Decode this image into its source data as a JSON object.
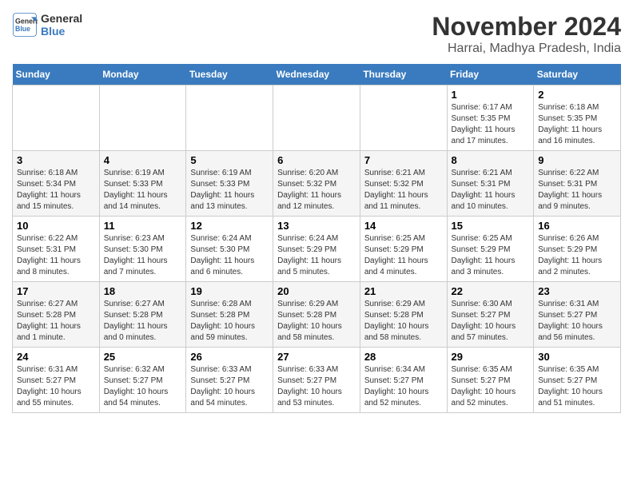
{
  "header": {
    "logo_line1": "General",
    "logo_line2": "Blue",
    "month": "November 2024",
    "location": "Harrai, Madhya Pradesh, India"
  },
  "weekdays": [
    "Sunday",
    "Monday",
    "Tuesday",
    "Wednesday",
    "Thursday",
    "Friday",
    "Saturday"
  ],
  "weeks": [
    [
      {
        "day": "",
        "info": ""
      },
      {
        "day": "",
        "info": ""
      },
      {
        "day": "",
        "info": ""
      },
      {
        "day": "",
        "info": ""
      },
      {
        "day": "",
        "info": ""
      },
      {
        "day": "1",
        "info": "Sunrise: 6:17 AM\nSunset: 5:35 PM\nDaylight: 11 hours and 17 minutes."
      },
      {
        "day": "2",
        "info": "Sunrise: 6:18 AM\nSunset: 5:35 PM\nDaylight: 11 hours and 16 minutes."
      }
    ],
    [
      {
        "day": "3",
        "info": "Sunrise: 6:18 AM\nSunset: 5:34 PM\nDaylight: 11 hours and 15 minutes."
      },
      {
        "day": "4",
        "info": "Sunrise: 6:19 AM\nSunset: 5:33 PM\nDaylight: 11 hours and 14 minutes."
      },
      {
        "day": "5",
        "info": "Sunrise: 6:19 AM\nSunset: 5:33 PM\nDaylight: 11 hours and 13 minutes."
      },
      {
        "day": "6",
        "info": "Sunrise: 6:20 AM\nSunset: 5:32 PM\nDaylight: 11 hours and 12 minutes."
      },
      {
        "day": "7",
        "info": "Sunrise: 6:21 AM\nSunset: 5:32 PM\nDaylight: 11 hours and 11 minutes."
      },
      {
        "day": "8",
        "info": "Sunrise: 6:21 AM\nSunset: 5:31 PM\nDaylight: 11 hours and 10 minutes."
      },
      {
        "day": "9",
        "info": "Sunrise: 6:22 AM\nSunset: 5:31 PM\nDaylight: 11 hours and 9 minutes."
      }
    ],
    [
      {
        "day": "10",
        "info": "Sunrise: 6:22 AM\nSunset: 5:31 PM\nDaylight: 11 hours and 8 minutes."
      },
      {
        "day": "11",
        "info": "Sunrise: 6:23 AM\nSunset: 5:30 PM\nDaylight: 11 hours and 7 minutes."
      },
      {
        "day": "12",
        "info": "Sunrise: 6:24 AM\nSunset: 5:30 PM\nDaylight: 11 hours and 6 minutes."
      },
      {
        "day": "13",
        "info": "Sunrise: 6:24 AM\nSunset: 5:29 PM\nDaylight: 11 hours and 5 minutes."
      },
      {
        "day": "14",
        "info": "Sunrise: 6:25 AM\nSunset: 5:29 PM\nDaylight: 11 hours and 4 minutes."
      },
      {
        "day": "15",
        "info": "Sunrise: 6:25 AM\nSunset: 5:29 PM\nDaylight: 11 hours and 3 minutes."
      },
      {
        "day": "16",
        "info": "Sunrise: 6:26 AM\nSunset: 5:29 PM\nDaylight: 11 hours and 2 minutes."
      }
    ],
    [
      {
        "day": "17",
        "info": "Sunrise: 6:27 AM\nSunset: 5:28 PM\nDaylight: 11 hours and 1 minute."
      },
      {
        "day": "18",
        "info": "Sunrise: 6:27 AM\nSunset: 5:28 PM\nDaylight: 11 hours and 0 minutes."
      },
      {
        "day": "19",
        "info": "Sunrise: 6:28 AM\nSunset: 5:28 PM\nDaylight: 10 hours and 59 minutes."
      },
      {
        "day": "20",
        "info": "Sunrise: 6:29 AM\nSunset: 5:28 PM\nDaylight: 10 hours and 58 minutes."
      },
      {
        "day": "21",
        "info": "Sunrise: 6:29 AM\nSunset: 5:28 PM\nDaylight: 10 hours and 58 minutes."
      },
      {
        "day": "22",
        "info": "Sunrise: 6:30 AM\nSunset: 5:27 PM\nDaylight: 10 hours and 57 minutes."
      },
      {
        "day": "23",
        "info": "Sunrise: 6:31 AM\nSunset: 5:27 PM\nDaylight: 10 hours and 56 minutes."
      }
    ],
    [
      {
        "day": "24",
        "info": "Sunrise: 6:31 AM\nSunset: 5:27 PM\nDaylight: 10 hours and 55 minutes."
      },
      {
        "day": "25",
        "info": "Sunrise: 6:32 AM\nSunset: 5:27 PM\nDaylight: 10 hours and 54 minutes."
      },
      {
        "day": "26",
        "info": "Sunrise: 6:33 AM\nSunset: 5:27 PM\nDaylight: 10 hours and 54 minutes."
      },
      {
        "day": "27",
        "info": "Sunrise: 6:33 AM\nSunset: 5:27 PM\nDaylight: 10 hours and 53 minutes."
      },
      {
        "day": "28",
        "info": "Sunrise: 6:34 AM\nSunset: 5:27 PM\nDaylight: 10 hours and 52 minutes."
      },
      {
        "day": "29",
        "info": "Sunrise: 6:35 AM\nSunset: 5:27 PM\nDaylight: 10 hours and 52 minutes."
      },
      {
        "day": "30",
        "info": "Sunrise: 6:35 AM\nSunset: 5:27 PM\nDaylight: 10 hours and 51 minutes."
      }
    ]
  ]
}
